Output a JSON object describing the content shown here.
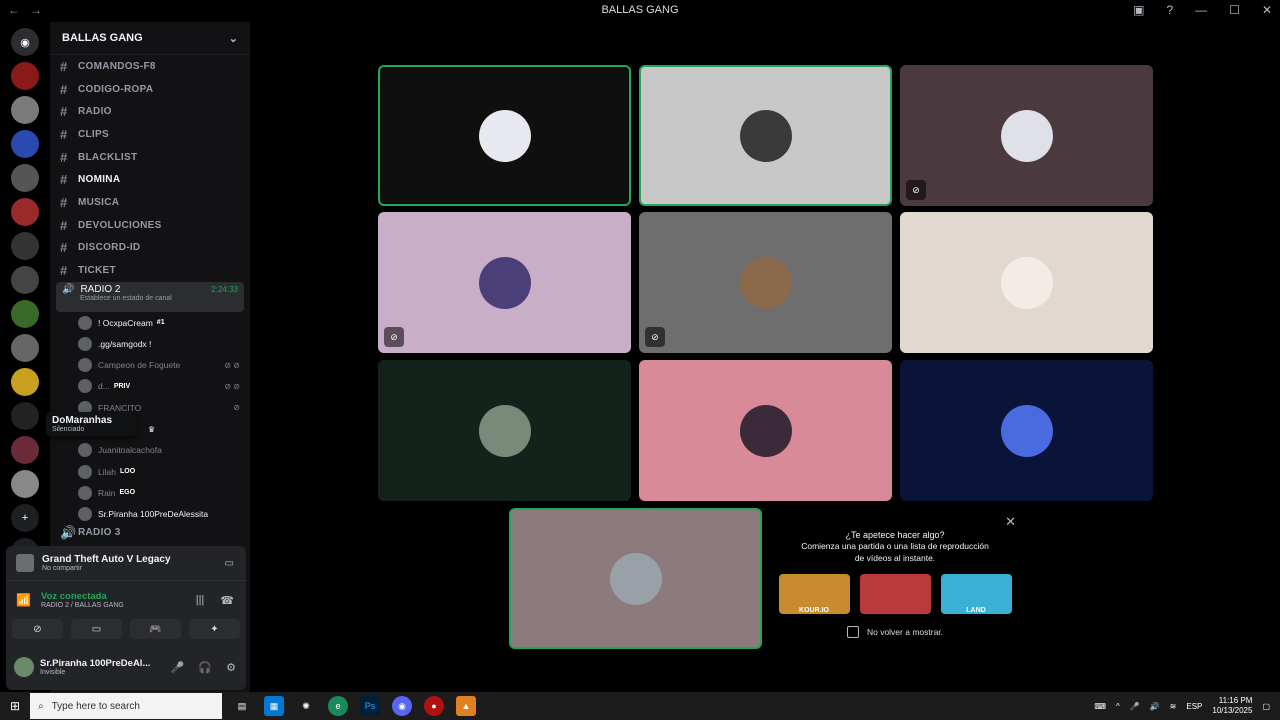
{
  "window": {
    "title": "BALLAS GANG",
    "back": "←",
    "forward": "→"
  },
  "server": {
    "name": "BALLAS GANG"
  },
  "channels": [
    {
      "label": "COMANDOS-F8"
    },
    {
      "label": "CODIGO-ROPA"
    },
    {
      "label": "RADIO"
    },
    {
      "label": "CLIPS"
    },
    {
      "label": "BLACKLIST"
    },
    {
      "label": "NOMINA"
    },
    {
      "label": "MUSICA"
    },
    {
      "label": "DEVOLUCIONES"
    },
    {
      "label": "DISCORD-ID"
    },
    {
      "label": "TICKET"
    }
  ],
  "voice_channel": {
    "name": "RADIO 2",
    "time": "2:24:33",
    "status": "Establece un estado de canal"
  },
  "members": [
    {
      "name": "! OcxpaCream",
      "tag": "#1"
    },
    {
      "name": ".gg/samgodx !",
      "tag": ""
    },
    {
      "name": "Campeon de Foguete",
      "tag": ""
    },
    {
      "name": "d...",
      "tag": "PRIV"
    },
    {
      "name": "FRANCITO",
      "tag": ""
    },
    {
      "name": "",
      "tag": ""
    },
    {
      "name": "Juanitoalcachofa",
      "tag": ""
    },
    {
      "name": "Lilah",
      "tag": "LOO"
    },
    {
      "name": "Rain",
      "tag": "EGO"
    },
    {
      "name": "Sr.Piranha 100PreDeAlessita",
      "tag": ""
    }
  ],
  "next_voice": {
    "name": "RADIO 3"
  },
  "tooltip": {
    "name": "DoMaranhas",
    "status": "Silenciado"
  },
  "activity": {
    "game": "Grand Theft Auto V Legacy",
    "sub": "No compartir"
  },
  "voice_connected": {
    "label": "Voz conectada",
    "location": "RADIO 2 / BALLAS GANG"
  },
  "user": {
    "name": "Sr.Piranha 100PreDeAl...",
    "status": "Invisible"
  },
  "suggestion": {
    "question": "¿Te apetece hacer algo?",
    "line1": "Comienza una partida o una lista de reproducción",
    "line2": "de vídeos al instante.",
    "games": [
      {
        "label": "KOUR.IO",
        "color": "#c98b2e"
      },
      {
        "label": "",
        "color": "#b83a3a"
      },
      {
        "label": "LAND",
        "color": "#3ab0d8"
      }
    ],
    "checkbox": "No volver a mostrar."
  },
  "taskbar": {
    "search_placeholder": "Type here to search",
    "lang": "ESP",
    "time": "11:16 PM",
    "date": "10/13/2025"
  },
  "tiles": [
    {
      "bg": "#0f0f0f",
      "av": "#e8e8f0",
      "speaking": true,
      "badge": false
    },
    {
      "bg": "#c8c8c8",
      "av": "#3a3a3a",
      "speaking": true,
      "badge": false
    },
    {
      "bg": "#4a3a40",
      "av": "#e0e0e8",
      "speaking": false,
      "badge": true
    },
    {
      "bg": "#c9aec8",
      "av": "#4b3f7a",
      "speaking": false,
      "badge": true
    },
    {
      "bg": "#6e6e6e",
      "av": "#8a6a4a",
      "speaking": false,
      "badge": true
    },
    {
      "bg": "#e1d8d0",
      "av": "#f2ece6",
      "speaking": false,
      "badge": false
    },
    {
      "bg": "#13221a",
      "av": "#7a8a7a",
      "speaking": false,
      "badge": false
    },
    {
      "bg": "#d88a98",
      "av": "#3a2a3a",
      "speaking": false,
      "badge": false
    },
    {
      "bg": "#0a1438",
      "av": "#4a6ae0",
      "speaking": false,
      "badge": false
    },
    {
      "bg": "#8c7a7c",
      "av": "#9aa0a8",
      "speaking": true,
      "badge": false
    }
  ]
}
